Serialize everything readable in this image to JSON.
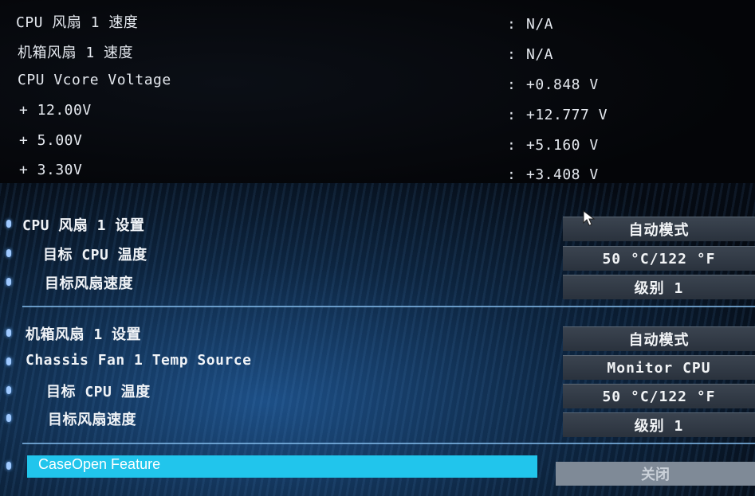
{
  "monitor": [
    {
      "label": "CPU 风扇 1 速度",
      "value": "N/A"
    },
    {
      "label": "机箱风扇 1 速度",
      "value": "N/A"
    },
    {
      "label": "CPU Vcore Voltage",
      "value": "+0.848 V"
    },
    {
      "label": "+ 12.00V",
      "value": "+12.777 V"
    },
    {
      "label": "+ 5.00V",
      "value": "+5.160 V"
    },
    {
      "label": "+ 3.30V",
      "value": "+3.408 V"
    }
  ],
  "colon": ":",
  "cpu_fan": {
    "setting_label": "CPU 风扇 1 设置",
    "setting_value": "自动模式",
    "target_temp_label": "目标 CPU 温度",
    "target_temp_value": "50 °C/122 °F",
    "target_speed_label": "目标风扇速度",
    "target_speed_value": "级别 1"
  },
  "chassis_fan": {
    "setting_label": "机箱风扇 1 设置",
    "setting_value": "自动模式",
    "temp_source_label": "Chassis Fan 1 Temp Source",
    "temp_source_value": "Monitor CPU",
    "target_temp_label": "目标 CPU 温度",
    "target_temp_value": "50 °C/122 °F",
    "target_speed_label": "目标风扇速度",
    "target_speed_value": "级别 1"
  },
  "case_open": {
    "label": "CaseOpen Feature",
    "value": "关闭"
  },
  "colors": {
    "highlight": "#21c5ec",
    "indicator": "#9fc9ff",
    "button": "#2f3843"
  }
}
